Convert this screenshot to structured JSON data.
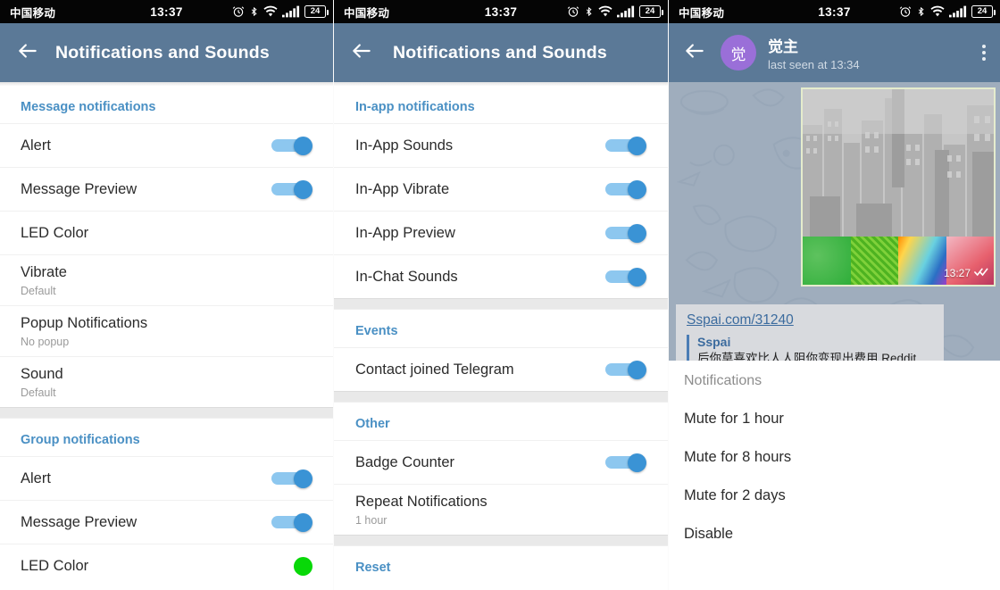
{
  "statusbar": {
    "carrier": "中国移动",
    "time": "13:37",
    "battery_level": "24",
    "icons": [
      "alarm-icon",
      "bluetooth-icon",
      "wifi-icon",
      "signal-icon",
      "battery-icon"
    ]
  },
  "screen1": {
    "appbar": {
      "title": "Notifications and Sounds",
      "back_icon": "arrow-left-icon"
    },
    "sections": [
      {
        "header": "Message notifications",
        "rows": [
          {
            "title": "Alert",
            "sub": "",
            "control": "toggle-on"
          },
          {
            "title": "Message Preview",
            "sub": "",
            "control": "toggle-on"
          },
          {
            "title": "LED Color",
            "sub": "",
            "control": "none"
          },
          {
            "title": "Vibrate",
            "sub": "Default",
            "control": "none"
          },
          {
            "title": "Popup Notifications",
            "sub": "No popup",
            "control": "none"
          },
          {
            "title": "Sound",
            "sub": "Default",
            "control": "none"
          }
        ]
      },
      {
        "header": "Group notifications",
        "rows": [
          {
            "title": "Alert",
            "sub": "",
            "control": "toggle-on"
          },
          {
            "title": "Message Preview",
            "sub": "",
            "control": "toggle-on"
          },
          {
            "title": "LED Color",
            "sub": "",
            "control": "led-dot"
          }
        ]
      }
    ]
  },
  "screen2": {
    "appbar": {
      "title": "Notifications and Sounds",
      "back_icon": "arrow-left-icon"
    },
    "sections": [
      {
        "header": "In-app notifications",
        "rows": [
          {
            "title": "In-App Sounds",
            "sub": "",
            "control": "toggle-on"
          },
          {
            "title": "In-App Vibrate",
            "sub": "",
            "control": "toggle-on"
          },
          {
            "title": "In-App Preview",
            "sub": "",
            "control": "toggle-on"
          },
          {
            "title": "In-Chat Sounds",
            "sub": "",
            "control": "toggle-on"
          }
        ]
      },
      {
        "header": "Events",
        "rows": [
          {
            "title": "Contact joined Telegram",
            "sub": "",
            "control": "toggle-on"
          }
        ]
      },
      {
        "header": "Other",
        "rows": [
          {
            "title": "Badge Counter",
            "sub": "",
            "control": "toggle-on"
          },
          {
            "title": "Repeat Notifications",
            "sub": "1 hour",
            "control": "none"
          }
        ]
      },
      {
        "header": "Reset",
        "rows": []
      }
    ]
  },
  "screen3": {
    "appbar": {
      "back_icon": "arrow-left-icon",
      "avatar_initial": "觉",
      "avatar_color": "#9a6fd8",
      "name": "觉主",
      "status": "last seen at 13:34",
      "menu_icon": "overflow-menu-icon"
    },
    "message": {
      "time": "13:27",
      "read_icon": "double-check-icon"
    },
    "link_preview": {
      "url": "Sspai.com/31240",
      "title": "Sspai",
      "description": "后你莫喜欢比人人阻你变现出费用 Reddit"
    },
    "sheet": {
      "title": "Notifications",
      "items": [
        "Mute for 1 hour",
        "Mute for 8 hours",
        "Mute for 2 days",
        "Disable"
      ]
    }
  },
  "colors": {
    "appbar": "#5b7997",
    "accent_blue": "#4a90c4",
    "toggle_track": "#8dc7ef",
    "toggle_thumb": "#3a93d5",
    "led_green": "#08d808",
    "chat_background": "#9fadbd"
  }
}
